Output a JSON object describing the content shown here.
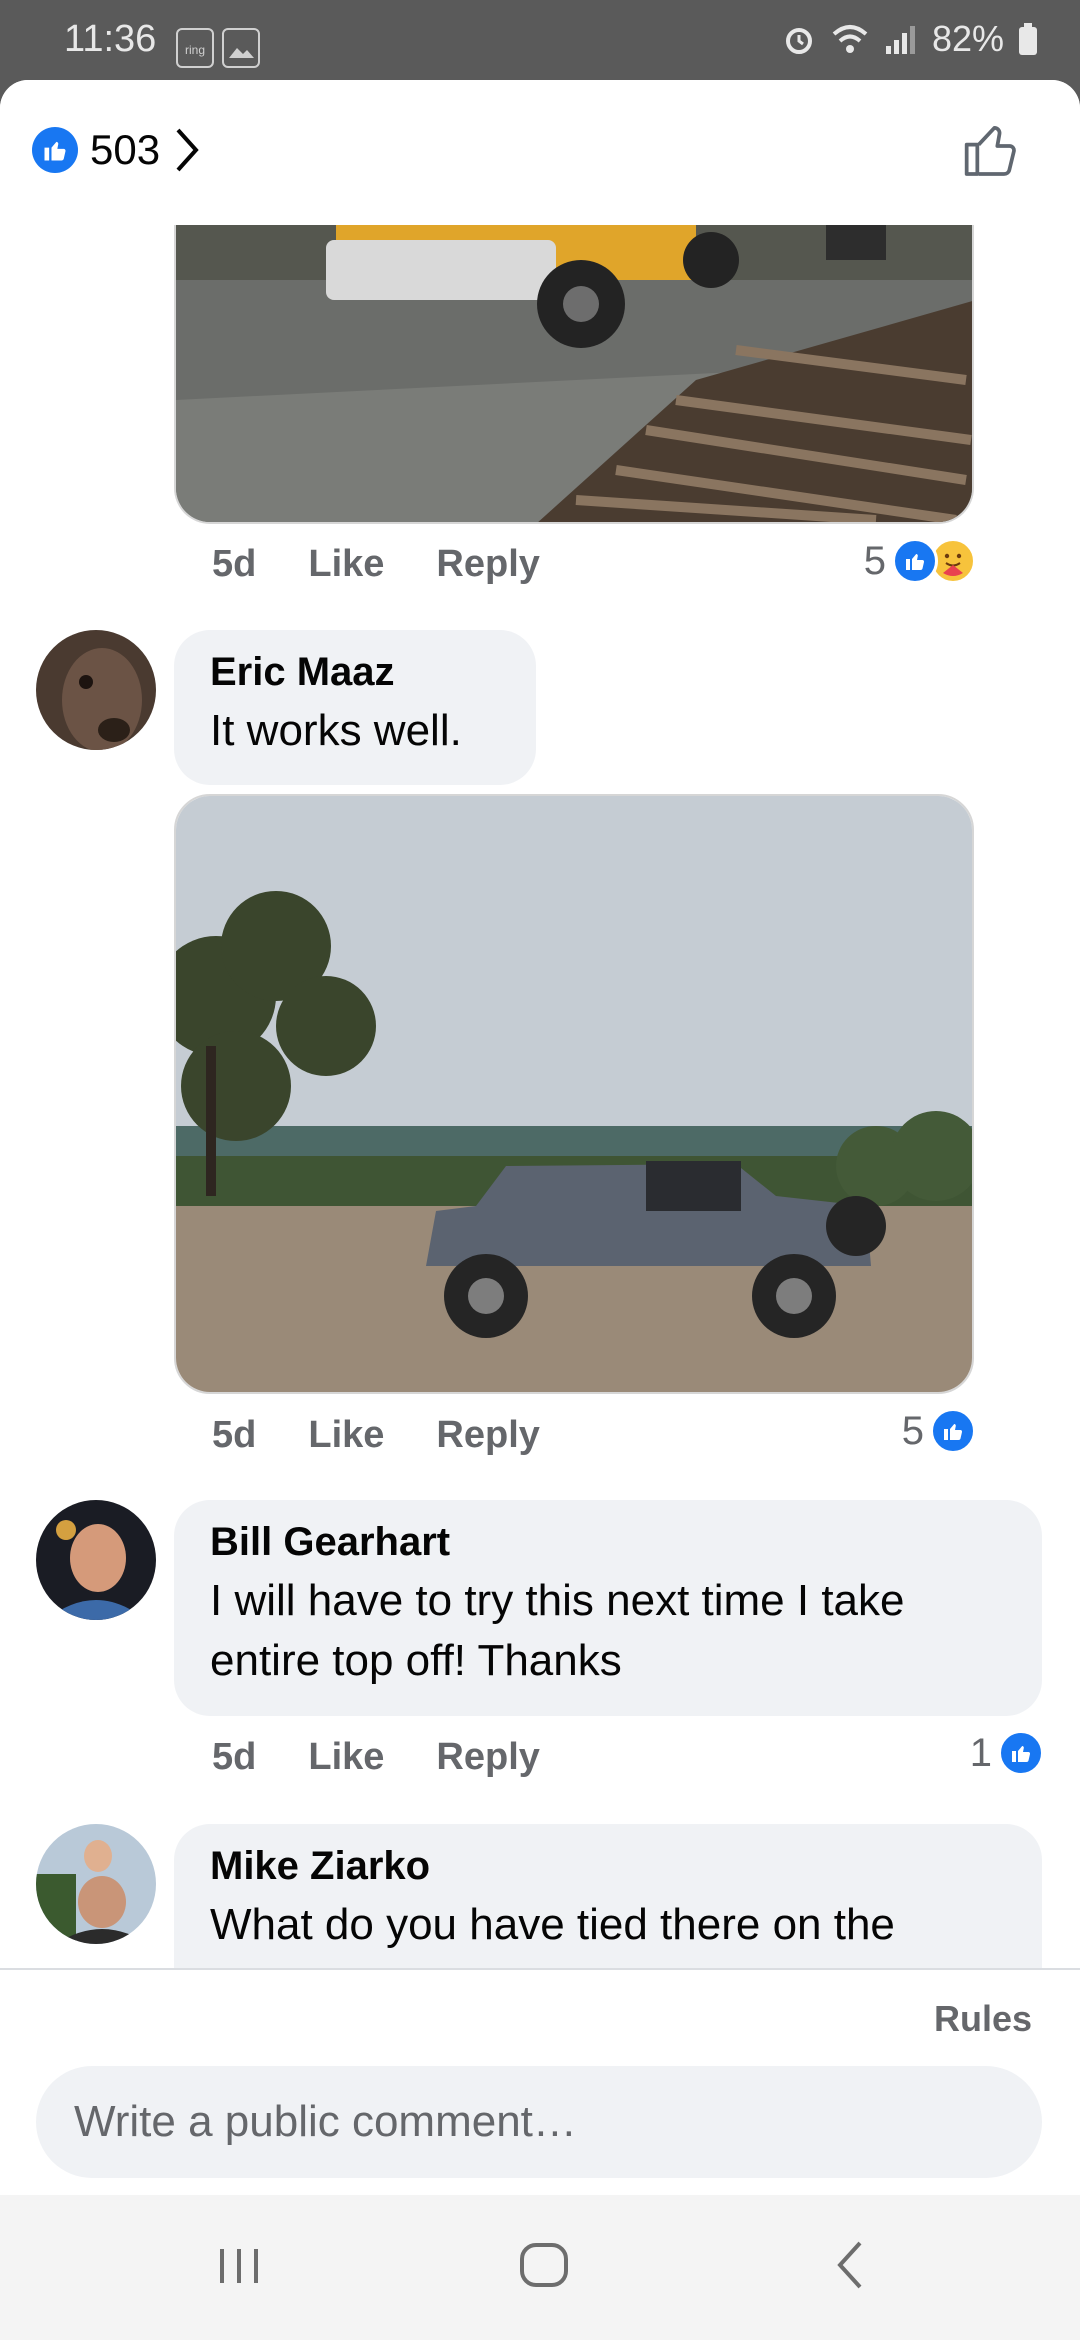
{
  "status_bar": {
    "time": "11:36",
    "battery": "82%"
  },
  "header": {
    "reaction_count": "503"
  },
  "comments": [
    {
      "time": "5d",
      "like": "Like",
      "reply": "Reply",
      "reactions": "5"
    },
    {
      "name": "Eric Maaz",
      "text": "It works well.",
      "time": "5d",
      "like": "Like",
      "reply": "Reply",
      "reactions": "5"
    },
    {
      "name": "Bill Gearhart",
      "text": "I will have to try this next time I take entire top off! Thanks",
      "time": "5d",
      "like": "Like",
      "reply": "Reply",
      "reactions": "1"
    },
    {
      "name": "Mike Ziarko",
      "text": "What do you have tied there on the"
    }
  ],
  "footer": {
    "rules": "Rules",
    "comment_placeholder": "Write a public comment…"
  },
  "colors": {
    "brand": "#1877f2",
    "bubble": "#f0f2f5",
    "meta": "#65676b"
  },
  "icons": [
    "like-badge-icon",
    "chevron-right-icon",
    "thumbs-up-outline-icon",
    "care-emoji-icon",
    "recents-icon",
    "home-icon",
    "back-icon"
  ]
}
